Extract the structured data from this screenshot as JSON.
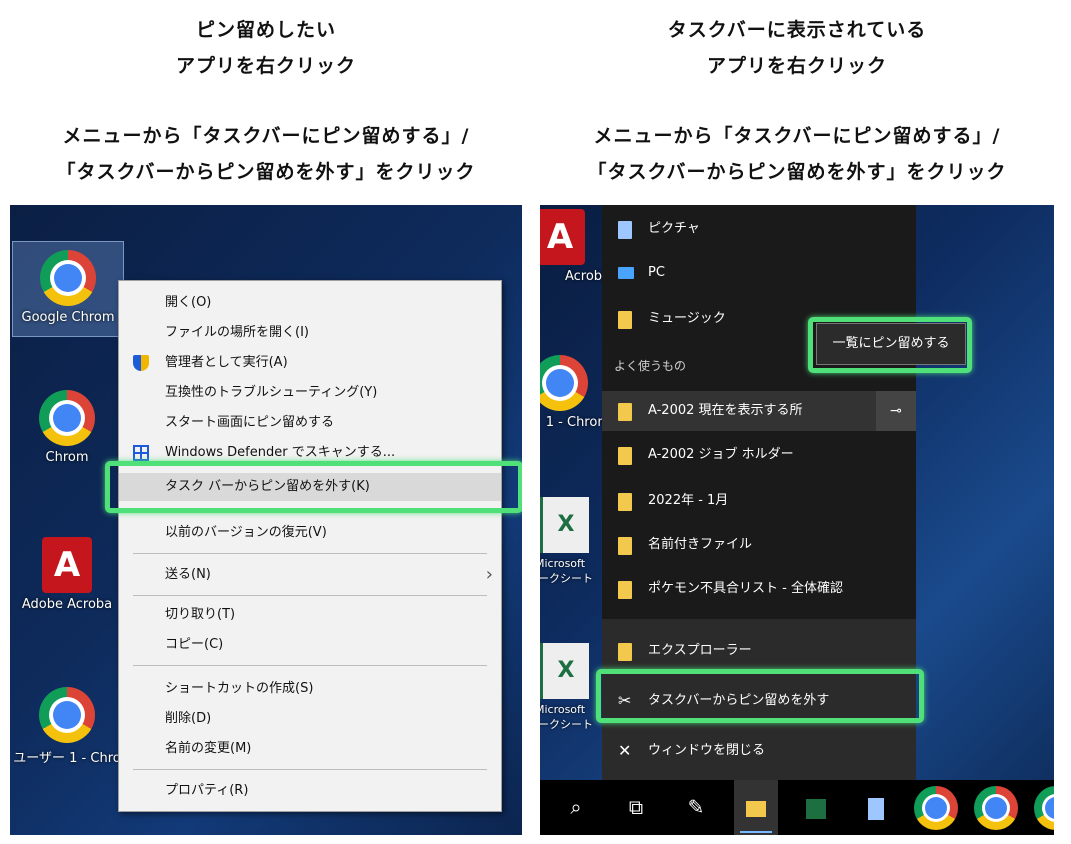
{
  "left": {
    "caption_line1": "ピン留めしたい",
    "caption_line2": "アプリを右クリック",
    "instruction_line1": "メニューから「タスクバーにピン留めする」/",
    "instruction_line2": "「タスクバーからピン留めを外す」をクリック",
    "desktop_icons": [
      "Google Chrom",
      "Chrom",
      "Adobe Acroba",
      "ユーザー 1 - Chro"
    ],
    "menu": {
      "open": "開く(O)",
      "open_location": "ファイルの場所を開く(I)",
      "run_admin": "管理者として実行(A)",
      "troubleshoot": "互換性のトラブルシューティング(Y)",
      "pin_start": "スタート画面にピン留めする",
      "defender": "Windows Defender でスキャンする...",
      "unpin_taskbar": "タスク バーからピン留めを外す(K)",
      "restore": "以前のバージョンの復元(V)",
      "send_to": "送る(N)",
      "cut": "切り取り(T)",
      "copy": "コピー(C)",
      "shortcut": "ショートカットの作成(S)",
      "delete": "削除(D)",
      "rename": "名前の変更(M)",
      "properties": "プロパティ(R)"
    }
  },
  "right": {
    "caption_line1": "タスクバーに表示されている",
    "caption_line2": "アプリを右クリック",
    "instruction_line1": "メニューから「タスクバーにピン留めする」/",
    "instruction_line2": "「タスクバーからピン留めを外す」をクリック",
    "desktop_icons": [
      "Acroba",
      "1 - Chrom",
      "Microsoft\nワークシート",
      "Microsoft\nワークシート"
    ],
    "jumplist": {
      "pictures": "ピクチャ",
      "pc": "PC",
      "music": "ミュージック",
      "recent_header": "よく使うもの",
      "item1": "A-2002 現在を表示する所",
      "item2": "A-2002 ジョブ ホルダー",
      "item3": "2022年 - 1月",
      "item4": "名前付きファイル",
      "item5": "ポケモン不具合リスト - 全体確認",
      "explorer": "エクスプローラー",
      "unpin": "タスクバーからピン留めを外す",
      "close": "ウィンドウを閉じる",
      "tooltip": "一覧にピン留めする"
    }
  }
}
